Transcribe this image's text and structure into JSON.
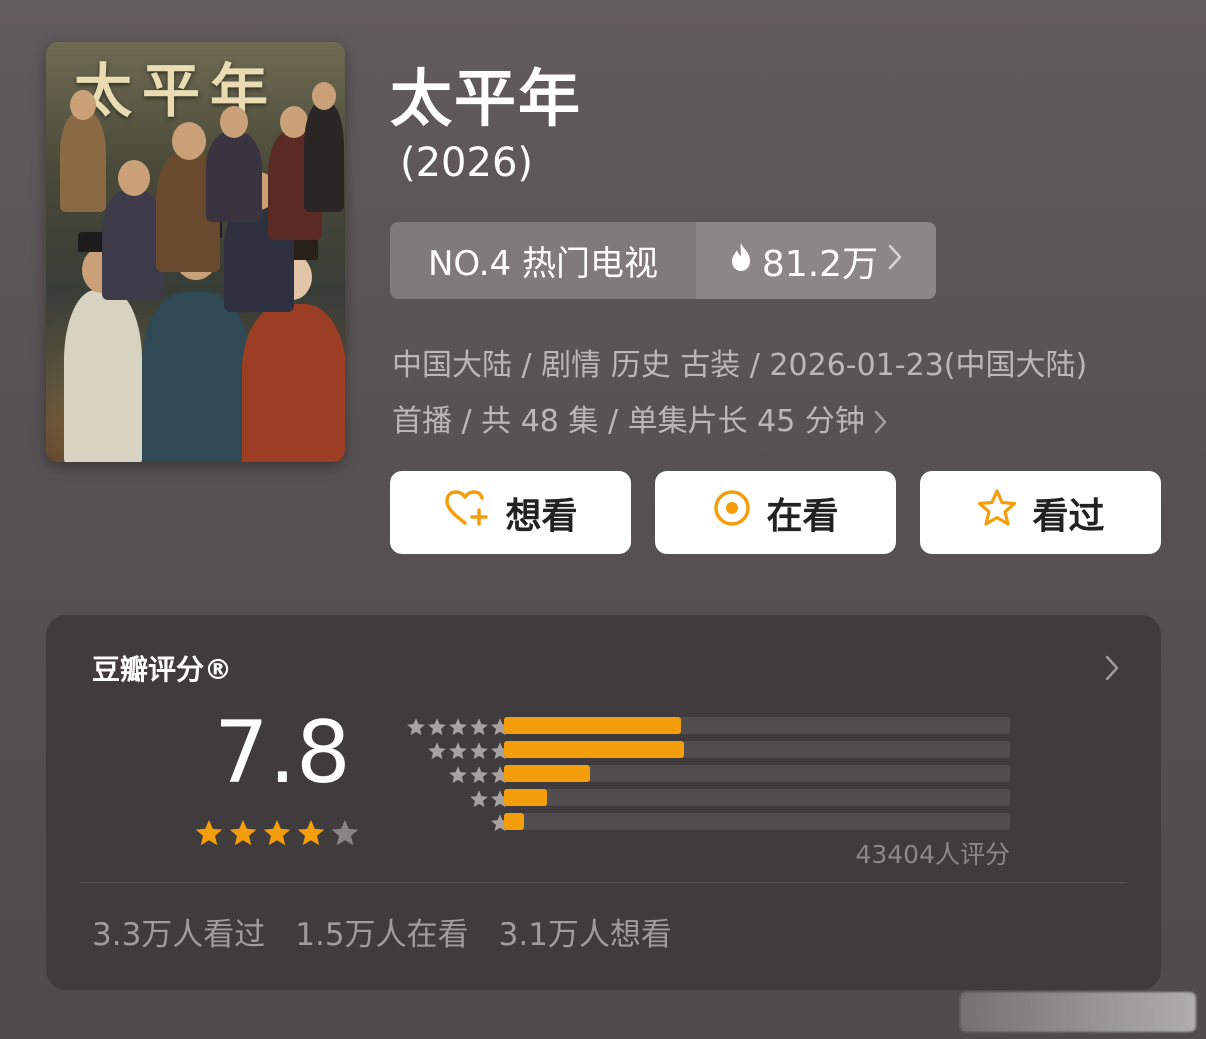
{
  "poster": {
    "title_text": "太平年"
  },
  "show": {
    "title": "太平年",
    "year": "(2026)"
  },
  "rank": {
    "label": "NO.4 热门电视",
    "heat": "81.2万"
  },
  "meta": {
    "line1": "中国大陆 / 剧情 历史 古装 / 2026-01-23(中国大陆)",
    "line2": "首播 / 共 48 集 / 单集片长 45 分钟"
  },
  "actions": {
    "want": "想看",
    "watching": "在看",
    "watched": "看过"
  },
  "rating": {
    "title": "豆瓣评分®",
    "score": "7.8",
    "stars_filled": 4,
    "stars_total": 5,
    "votes": "43404人评分",
    "distribution": [
      {
        "stars": 5,
        "fraction": 0.35
      },
      {
        "stars": 4,
        "fraction": 0.355
      },
      {
        "stars": 3,
        "fraction": 0.17
      },
      {
        "stars": 2,
        "fraction": 0.085
      },
      {
        "stars": 1,
        "fraction": 0.04
      }
    ],
    "stats": {
      "watched": "3.3万人看过",
      "watching": "1.5万人在看",
      "want": "3.1万人想看"
    }
  },
  "colors": {
    "accent": "#f59e0b",
    "star_empty": "#8a8486",
    "dist_star": "#a7a1a3"
  },
  "icons": {
    "heat": "flame-icon",
    "want": "heart-plus-icon",
    "watching": "target-icon",
    "watched": "star-outline-icon"
  }
}
